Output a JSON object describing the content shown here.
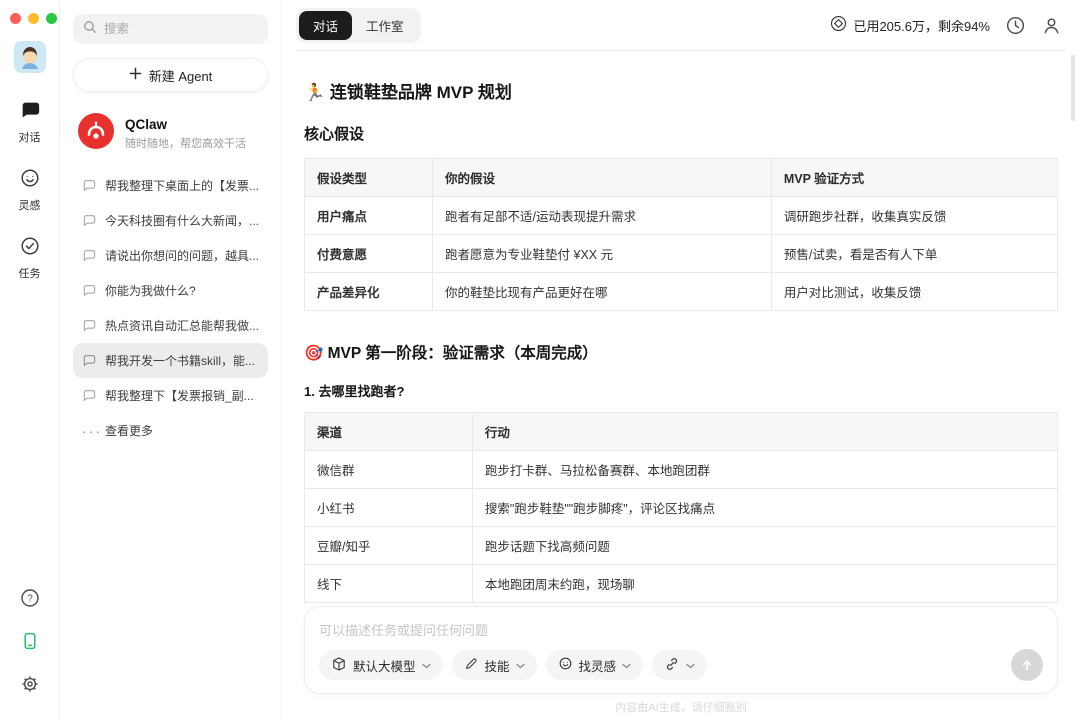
{
  "window": {
    "traffic_lights": [
      "#ff5f57",
      "#febc2e",
      "#28c840"
    ]
  },
  "colors": {
    "brand_red": "#e8312f",
    "accent_green": "#22c069",
    "active_tab_bg": "#1c1c1e",
    "send_button_bg": "#d7d7d7"
  },
  "rail": {
    "items": [
      {
        "label": "对话",
        "active": true
      },
      {
        "label": "灵感",
        "active": false
      },
      {
        "label": "任务",
        "active": false
      }
    ]
  },
  "sidebar": {
    "search_placeholder": "搜索",
    "new_agent_label": "新建 Agent",
    "agent": {
      "name": "QClaw",
      "tagline": "随时随地，帮您高效干活"
    },
    "history": [
      {
        "label": "帮我整理下桌面上的【发票...",
        "active": false
      },
      {
        "label": "今天科技圈有什么大新闻，...",
        "active": false
      },
      {
        "label": "请说出你想问的问题，越具...",
        "active": false
      },
      {
        "label": "你能为我做什么?",
        "active": false
      },
      {
        "label": "热点资讯自动汇总能帮我做...",
        "active": false
      },
      {
        "label": "帮我开发一个书籍skill，能...",
        "active": true
      },
      {
        "label": "帮我整理下【发票报销_副...",
        "active": false
      }
    ],
    "more_label": "查看更多"
  },
  "topbar": {
    "tabs": [
      {
        "label": "对话",
        "active": true
      },
      {
        "label": "工作室",
        "active": false
      }
    ],
    "usage": "已用205.6万，剩余94%"
  },
  "doc": {
    "title": "🏃 连锁鞋垫品牌 MVP 规划",
    "section1": "核心假设",
    "table1": {
      "headers": [
        "假设类型",
        "你的假设",
        "MVP 验证方式"
      ],
      "rows": [
        [
          "用户痛点",
          "跑者有足部不适/运动表现提升需求",
          "调研跑步社群，收集真实反馈"
        ],
        [
          "付费意愿",
          "跑者愿意为专业鞋垫付 ¥XX 元",
          "预售/试卖，看是否有人下单"
        ],
        [
          "产品差异化",
          "你的鞋垫比现有产品更好在哪",
          "用户对比测试，收集反馈"
        ]
      ]
    },
    "section2": "🎯 MVP 第一阶段：验证需求（本周完成）",
    "subsection1": "1. 去哪里找跑者?",
    "table2": {
      "headers": [
        "渠道",
        "行动"
      ],
      "rows": [
        [
          "微信群",
          "跑步打卡群、马拉松备赛群、本地跑团群"
        ],
        [
          "小红书",
          "搜索\"跑步鞋垫\"\"跑步脚疼\"，评论区找痛点"
        ],
        [
          "豆瓣/知乎",
          "跑步话题下找高频问题"
        ],
        [
          "线下",
          "本地跑团周末约跑，现场聊"
        ]
      ]
    }
  },
  "composer": {
    "placeholder": "可以描述任务或提问任何问题",
    "model_button": "默认大模型",
    "skills_button": "技能",
    "inspiration_button": "找灵感",
    "footer": "内容由AI生成，请仔细甄别"
  }
}
